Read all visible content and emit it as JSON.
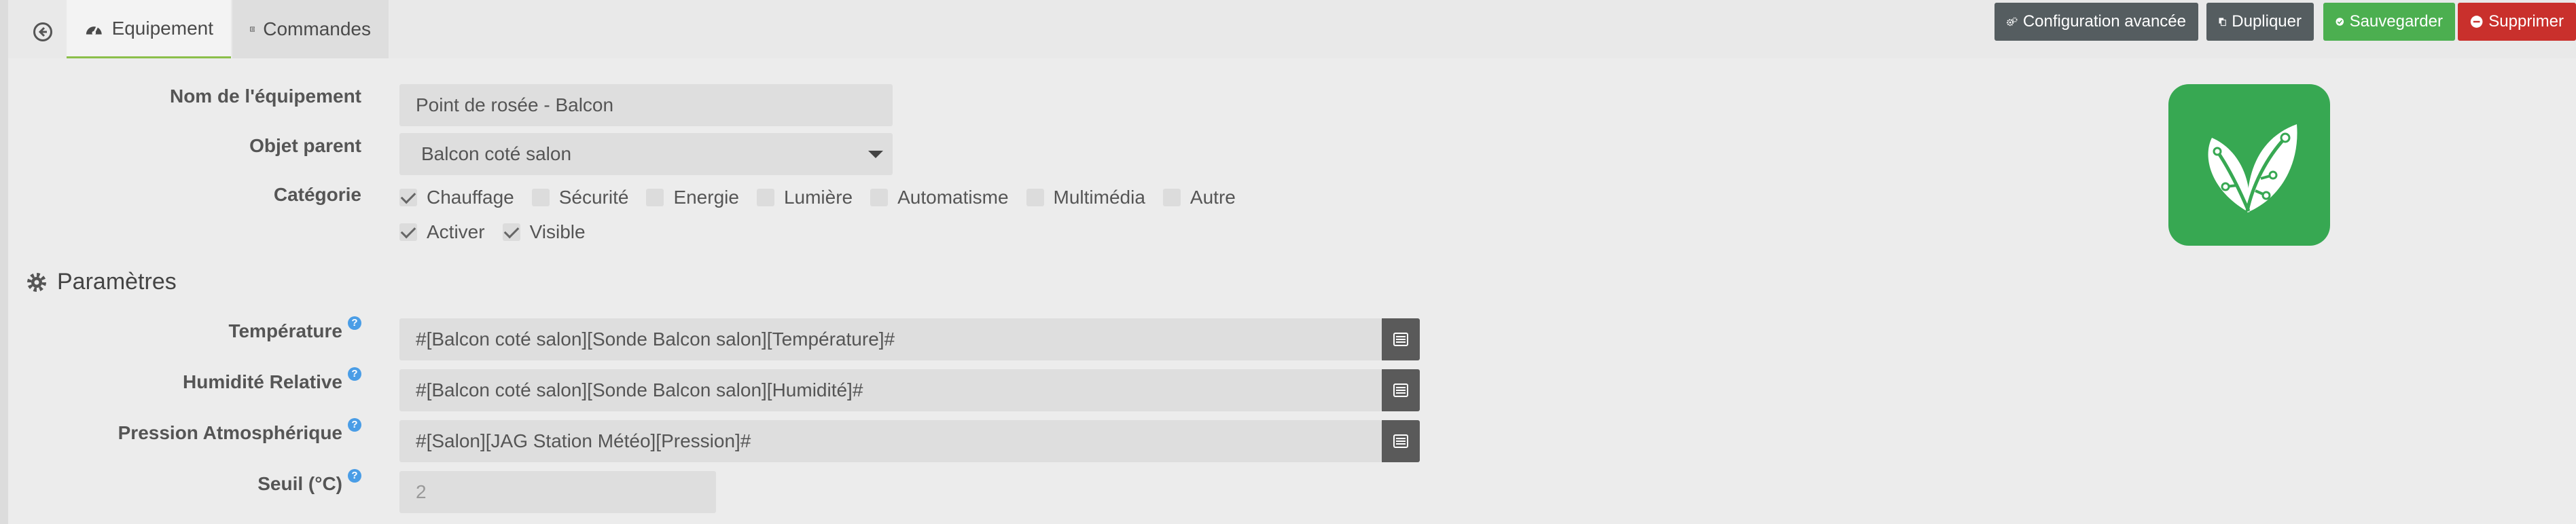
{
  "tabs": [
    {
      "label": "Equipement"
    },
    {
      "label": "Commandes"
    }
  ],
  "actions": {
    "config": "Configuration avancée",
    "duplicate": "Dupliquer",
    "save": "Sauvegarder",
    "delete": "Supprimer"
  },
  "form": {
    "name_label": "Nom de l'équipement",
    "name_value": "Point de rosée - Balcon",
    "parent_label": "Objet parent",
    "parent_value": "Balcon coté salon",
    "category_label": "Catégorie",
    "categories": [
      {
        "label": "Chauffage",
        "checked": true
      },
      {
        "label": "Sécurité",
        "checked": false
      },
      {
        "label": "Energie",
        "checked": false
      },
      {
        "label": "Lumière",
        "checked": false
      },
      {
        "label": "Automatisme",
        "checked": false
      },
      {
        "label": "Multimédia",
        "checked": false
      },
      {
        "label": "Autre",
        "checked": false
      }
    ],
    "options": [
      {
        "label": "Activer",
        "checked": true
      },
      {
        "label": "Visible",
        "checked": true
      }
    ]
  },
  "params": {
    "title": "Paramètres",
    "help": "?",
    "temperature_label": "Température",
    "temperature_value": "#[Balcon coté salon][Sonde Balcon salon][Température]#",
    "humidity_label": "Humidité Relative",
    "humidity_value": "#[Balcon coté salon][Sonde Balcon salon][Humidité]#",
    "pressure_label": "Pression Atmosphérique",
    "pressure_value": "#[Salon][JAG Station Météo][Pression]#",
    "threshold_label": "Seuil (°C)",
    "threshold_placeholder": "2"
  },
  "colors": {
    "save": "#4caf50",
    "delete": "#c9302c",
    "dark_button": "#555d60",
    "icon_bg": "#37a852",
    "help": "#4a9de6"
  }
}
